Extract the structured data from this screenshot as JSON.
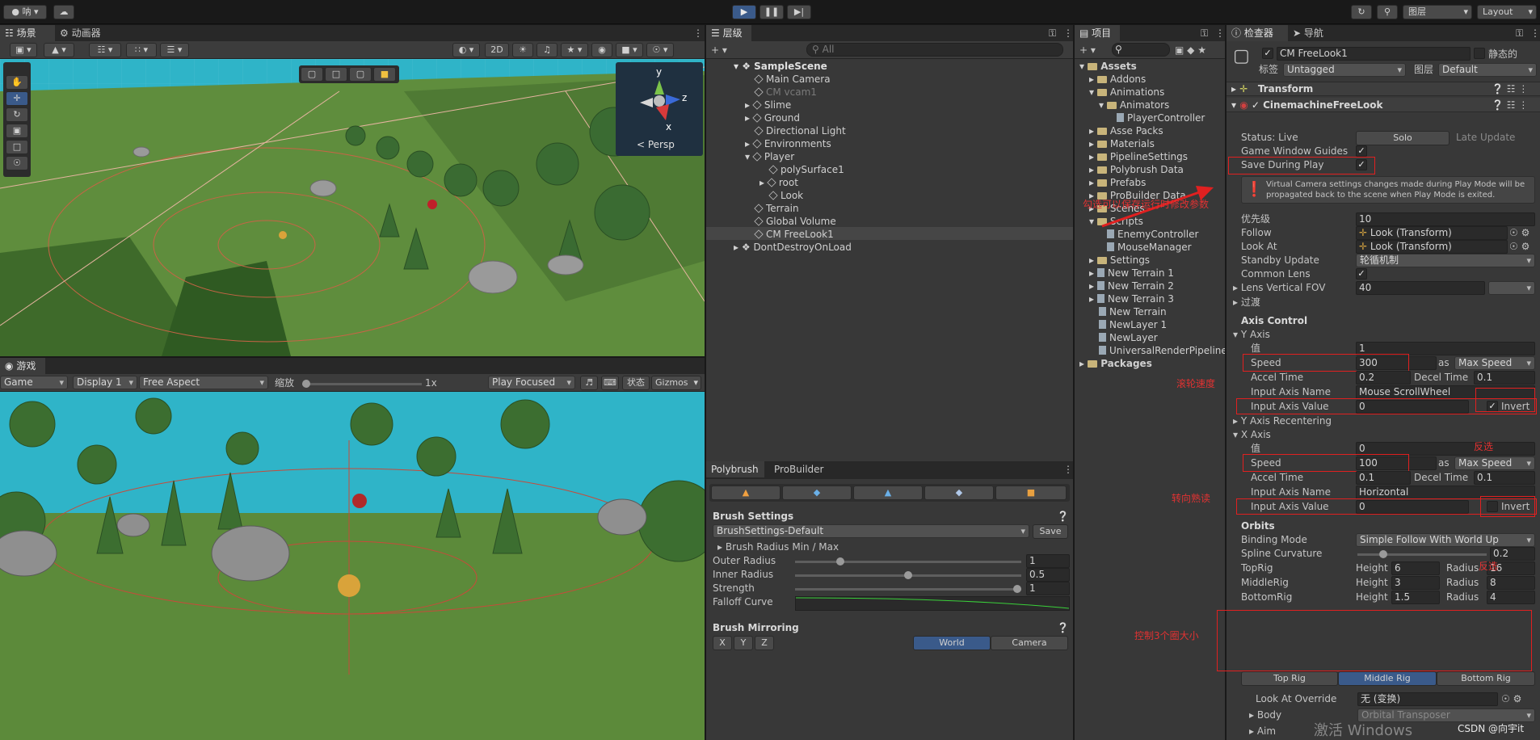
{
  "colors": {
    "app_bg": "#191919",
    "panel_bg": "#383838",
    "sky": "#2fb4c8",
    "grass": "#5d8a3c",
    "accent_blue": "#3a5a8a",
    "annotation_red": "#e02020"
  },
  "top_bar": {
    "account": "呐",
    "layers": "图层",
    "layout": "Layout"
  },
  "scene_panel": {
    "tabs": [
      "场景",
      "动画器"
    ],
    "toolbar": {
      "mode_2d": "2D"
    },
    "gizmo": {
      "y": "y",
      "z": "z",
      "x": "x",
      "persp": "< Persp"
    }
  },
  "game_panel": {
    "tab": "游戏",
    "game_dropdown": "Game",
    "display": "Display 1",
    "aspect": "Free Aspect",
    "scale_label": "缩放",
    "scale_value": "1x",
    "play_focused": "Play Focused",
    "stats": "状态",
    "gizmos": "Gizmos"
  },
  "hierarchy": {
    "tab": "层级",
    "search_placeholder": "All",
    "items": [
      "SampleScene",
      "Main Camera",
      "CM vcam1",
      "Slime",
      "Ground",
      "Directional Light",
      "Environments",
      "Player",
      "polySurface1",
      "root",
      "Look",
      "Terrain",
      "Global Volume",
      "CM FreeLook1",
      "DontDestroyOnLoad"
    ]
  },
  "project": {
    "tab": "项目",
    "items": [
      "Assets",
      "Addons",
      "Animations",
      "Animators",
      "PlayerController",
      "Asse Packs",
      "Materials",
      "PipelineSettings",
      "Polybrush Data",
      "Prefabs",
      "ProBuilder Data",
      "Scenes",
      "Scripts",
      "EnemyController",
      "MouseManager",
      "Settings",
      "New Terrain 1",
      "New Terrain 2",
      "New Terrain 3",
      "New Terrain",
      "NewLayer 1",
      "NewLayer",
      "UniversalRenderPipeline",
      "Packages"
    ]
  },
  "polybrush": {
    "tabs": [
      "Polybrush",
      "ProBuilder"
    ],
    "brush_settings": "Brush Settings",
    "preset": "BrushSettings-Default",
    "save": "Save",
    "radius_header": "Brush Radius Min / Max",
    "outer_label": "Outer Radius",
    "outer_value": "1",
    "outer_fraction": 0.2,
    "inner_label": "Inner Radius",
    "inner_value": "0.5",
    "inner_fraction": 0.5,
    "strength_label": "Strength",
    "strength_value": "1",
    "strength_fraction": 1.0,
    "falloff_label": "Falloff Curve",
    "mirroring": "Brush Mirroring",
    "axes": [
      "X",
      "Y",
      "Z"
    ],
    "world": "World",
    "camera": "Camera"
  },
  "inspector": {
    "tabs": [
      "检查器",
      "导航"
    ],
    "object_name": "CM FreeLook1",
    "static_label": "静态的",
    "tag_label": "标签",
    "tag_value": "Untagged",
    "layer_label": "图层",
    "layer_value": "Default",
    "transform": "Transform",
    "component": "CinemachineFreeLook",
    "status": "Status: Live",
    "solo": "Solo",
    "late_update": "Late Update",
    "game_window_guides": "Game Window Guides",
    "save_during_play": "Save During Play",
    "warning": "Virtual Camera settings changes made during Play Mode will be propagated back to the scene when Play Mode is exited.",
    "priority_label": "优先级",
    "priority_value": "10",
    "follow_label": "Follow",
    "follow_value": "Look (Transform)",
    "lookat_label": "Look At",
    "lookat_value": "Look (Transform)",
    "standby_label": "Standby Update",
    "standby_value": "轮循机制",
    "common_lens": "Common Lens",
    "fov_label": "Lens Vertical FOV",
    "fov_value": "40",
    "transition": "过渡",
    "axis_control": "Axis Control",
    "y_axis": {
      "title": "Y Axis",
      "value_label": "值",
      "value": "1",
      "speed_label": "Speed",
      "speed": "300",
      "as": "as",
      "speed_mode": "Max Speed",
      "accel_label": "Accel Time",
      "accel": "0.2",
      "decel_label": "Decel Time",
      "decel": "0.1",
      "input_name_label": "Input Axis Name",
      "input_name": "Mouse ScrollWheel",
      "input_value_label": "Input Axis Value",
      "input_value": "0",
      "invert": "Invert"
    },
    "y_recentering": "Y Axis Recentering",
    "x_axis": {
      "title": "X Axis",
      "value_label": "值",
      "value": "0",
      "speed_label": "Speed",
      "speed": "100",
      "as": "as",
      "speed_mode": "Max Speed",
      "accel_label": "Accel Time",
      "accel": "0.1",
      "decel_label": "Decel Time",
      "decel": "0.1",
      "input_name_label": "Input Axis Name",
      "input_name": "Horizontal",
      "input_value_label": "Input Axis Value",
      "input_value": "0",
      "invert": "Invert"
    },
    "orbits": "Orbits",
    "binding_label": "Binding Mode",
    "binding_value": "Simple Follow With World Up",
    "spline_label": "Spline Curvature",
    "spline_value": "0.2",
    "spline_fraction": 0.2,
    "rigs": [
      {
        "name": "TopRig",
        "height_label": "Height",
        "height": "6",
        "radius_label": "Radius",
        "radius": "16"
      },
      {
        "name": "MiddleRig",
        "height_label": "Height",
        "height": "3",
        "radius_label": "Radius",
        "radius": "8"
      },
      {
        "name": "BottomRig",
        "height_label": "Height",
        "height": "1.5",
        "radius_label": "Radius",
        "radius": "4"
      }
    ],
    "rig_tabs": [
      "Top Rig",
      "Middle Rig",
      "Bottom Rig"
    ],
    "look_at_override_label": "Look At Override",
    "look_at_override_value": "无 (变换)",
    "body_label": "Body",
    "body_value": "Orbital Transposer",
    "aim_label": "Aim"
  },
  "annotations": {
    "save_note": "勾选可以保存运行时修改参数",
    "scroll_speed": "滚轮速度",
    "invert_y": "反选",
    "turn_speed": "转向熟读",
    "invert_x": "反选",
    "rig_size": "控制3个圈大小"
  },
  "watermark": {
    "activate": "激活 Windows",
    "credit": "CSDN @向宇it"
  }
}
